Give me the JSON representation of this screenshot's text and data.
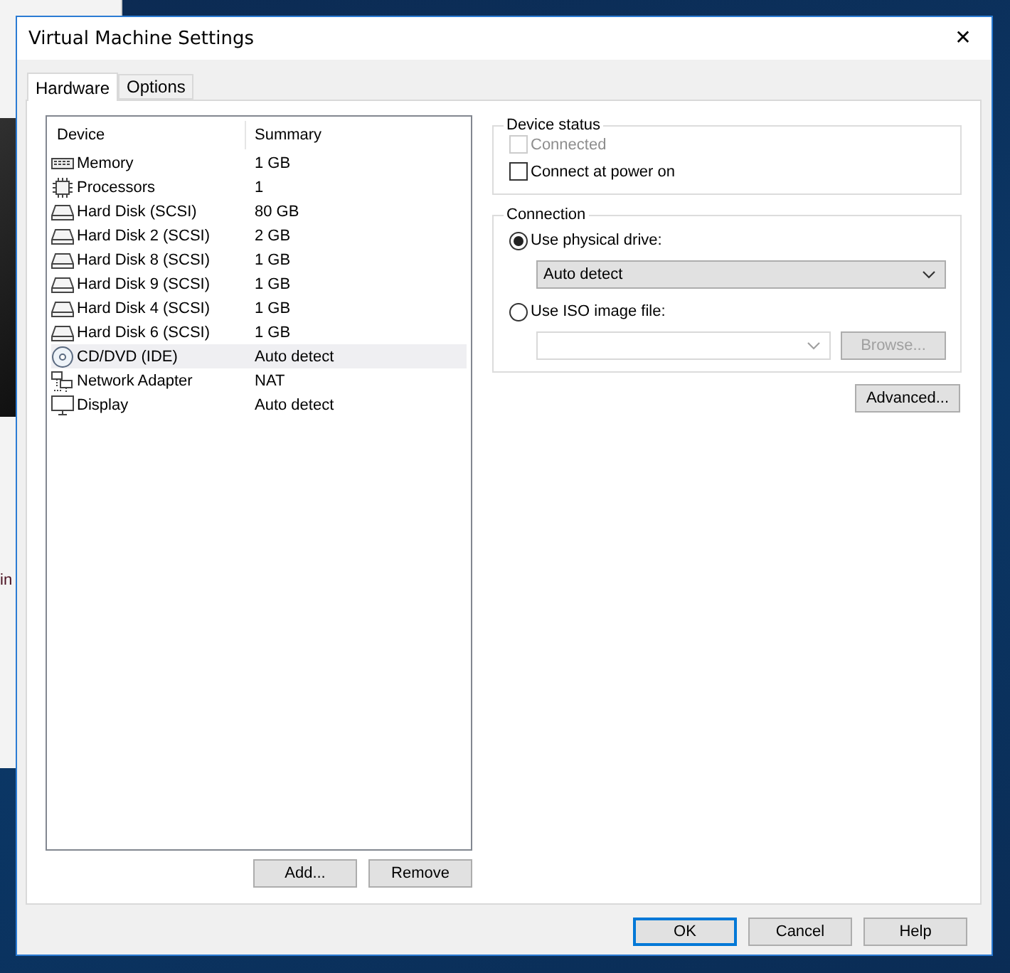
{
  "background_window": {
    "text": "in"
  },
  "window": {
    "title": "Virtual Machine Settings",
    "close": "✕"
  },
  "tabs": [
    {
      "label": "Hardware",
      "selected": true
    },
    {
      "label": "Options",
      "selected": false
    }
  ],
  "device_list": {
    "columns": [
      "Device",
      "Summary"
    ],
    "rows": [
      {
        "kind": "memory",
        "device": "Memory",
        "summary": "1 GB",
        "selected": false
      },
      {
        "kind": "processor",
        "device": "Processors",
        "summary": "1",
        "selected": false
      },
      {
        "kind": "disk",
        "device": "Hard Disk (SCSI)",
        "summary": "80 GB",
        "selected": false
      },
      {
        "kind": "disk",
        "device": "Hard Disk 2 (SCSI)",
        "summary": "2 GB",
        "selected": false
      },
      {
        "kind": "disk",
        "device": "Hard Disk 8 (SCSI)",
        "summary": "1 GB",
        "selected": false
      },
      {
        "kind": "disk",
        "device": "Hard Disk 9 (SCSI)",
        "summary": "1 GB",
        "selected": false
      },
      {
        "kind": "disk",
        "device": "Hard Disk 4 (SCSI)",
        "summary": "1 GB",
        "selected": false
      },
      {
        "kind": "disk",
        "device": "Hard Disk 6 (SCSI)",
        "summary": "1 GB",
        "selected": false
      },
      {
        "kind": "cd",
        "device": "CD/DVD (IDE)",
        "summary": "Auto detect",
        "selected": true
      },
      {
        "kind": "network",
        "device": "Network Adapter",
        "summary": "NAT",
        "selected": false
      },
      {
        "kind": "display",
        "device": "Display",
        "summary": "Auto detect",
        "selected": false
      }
    ],
    "buttons": [
      "Add...",
      "Remove"
    ]
  },
  "device_status": {
    "title": "Device status",
    "options": [
      {
        "label": "Connected",
        "checked": false,
        "disabled": true
      },
      {
        "label": "Connect at power on",
        "checked": false,
        "disabled": false
      }
    ]
  },
  "connection": {
    "title": "Connection",
    "physical_drive": {
      "label": "Use physical drive:",
      "selected": true,
      "value": "Auto detect"
    },
    "iso_file": {
      "label": "Use ISO image file:",
      "selected": false,
      "browse": "Browse..."
    }
  },
  "advanced_button": "Advanced...",
  "footer_buttons": [
    {
      "label": "OK",
      "default": true
    },
    {
      "label": "Cancel",
      "default": false
    },
    {
      "label": "Help",
      "default": false
    }
  ]
}
